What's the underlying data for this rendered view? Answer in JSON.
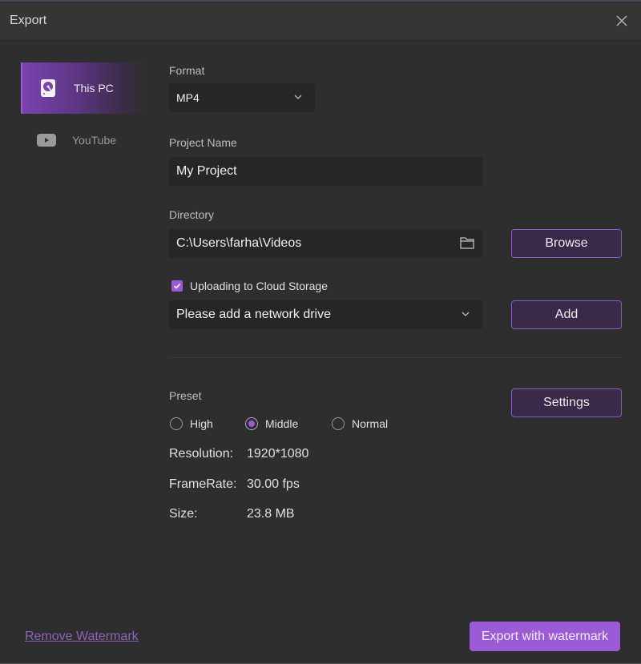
{
  "window": {
    "title": "Export"
  },
  "sidebar": {
    "items": [
      {
        "label": "This PC",
        "icon": "hard-drive-icon",
        "active": true
      },
      {
        "label": "YouTube",
        "icon": "youtube-icon",
        "active": false
      }
    ]
  },
  "format": {
    "label": "Format",
    "value": "MP4"
  },
  "project_name": {
    "label": "Project Name",
    "value": "My Project"
  },
  "directory": {
    "label": "Directory",
    "value": "C:\\Users\\farha\\Videos",
    "browse_label": "Browse"
  },
  "cloud": {
    "checkbox_label": "Uploading to Cloud Storage",
    "checked": true,
    "dropdown_value": "Please add a network drive",
    "add_label": "Add"
  },
  "preset": {
    "label": "Preset",
    "settings_label": "Settings",
    "options": [
      {
        "label": "High",
        "selected": false
      },
      {
        "label": "Middle",
        "selected": true
      },
      {
        "label": "Normal",
        "selected": false
      }
    ]
  },
  "info": {
    "resolution_key": "Resolution:",
    "resolution_val": "1920*1080",
    "framerate_key": "FrameRate:",
    "framerate_val": "30.00 fps",
    "size_key": "Size:",
    "size_val": "23.8 MB"
  },
  "footer": {
    "remove_watermark": "Remove Watermark",
    "export_label": "Export with watermark"
  },
  "colors": {
    "accent": "#9b5ad6",
    "background": "#2e2e2e",
    "titlebar": "#353535"
  }
}
